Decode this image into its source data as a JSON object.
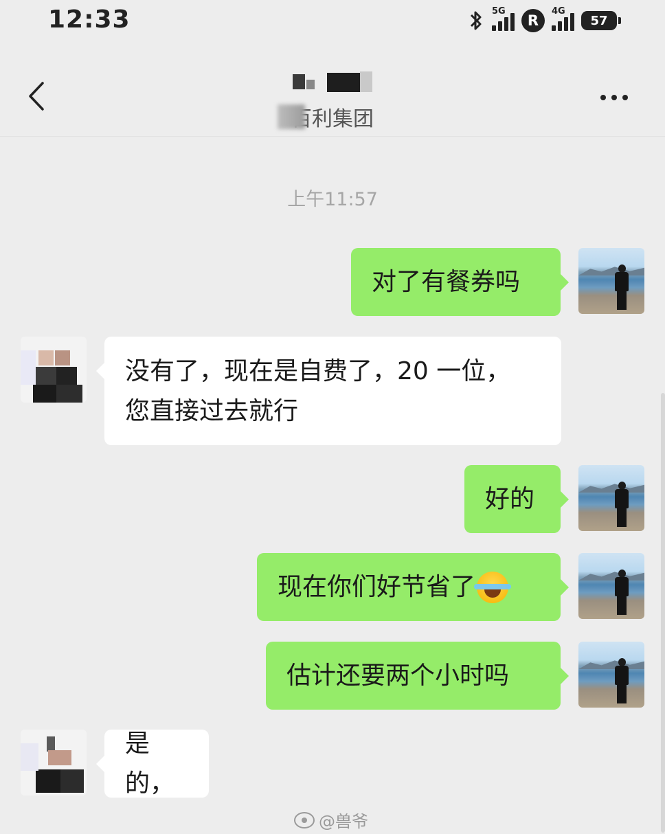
{
  "status_bar": {
    "time": "12:33",
    "network1": "5G",
    "roaming": "R",
    "network2": "4G",
    "battery": "57"
  },
  "header": {
    "subtitle": "百利集团"
  },
  "timestamp": "上午11:57",
  "messages": [
    {
      "side": "out",
      "text": "对了有餐券吗"
    },
    {
      "side": "in",
      "line1": "没有了，现在是自费了，20 一位，",
      "line2": "您直接过去就行"
    },
    {
      "side": "out",
      "text": "好的"
    },
    {
      "side": "out",
      "text": "现在你们好节省了",
      "emoji": "laughing-crying-emoji"
    },
    {
      "side": "out",
      "text": "估计还要两个小时吗"
    },
    {
      "side": "in",
      "text": "是的，"
    }
  ],
  "watermark": "@兽爷",
  "colors": {
    "out_bubble": "#95ec69",
    "in_bubble": "#ffffff",
    "background": "#ededed"
  }
}
